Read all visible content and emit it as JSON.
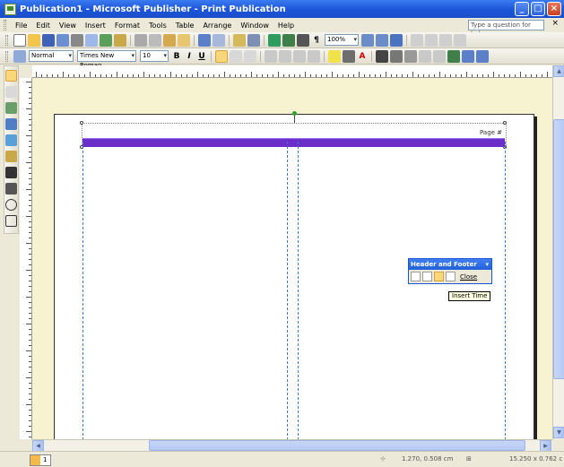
{
  "title_bar": {
    "title": "Publication1 - Microsoft Publisher - Print Publication"
  },
  "window_buttons": {
    "minimize": "_",
    "maximize": "□",
    "close": "×"
  },
  "menu": {
    "items": [
      "File",
      "Edit",
      "View",
      "Insert",
      "Format",
      "Tools",
      "Table",
      "Arrange",
      "Window",
      "Help"
    ],
    "help_placeholder": "Type a question for help",
    "close_glyph": "×"
  },
  "standard_toolbar": {
    "zoom": "100%"
  },
  "formatting_toolbar": {
    "style": "Normal",
    "font": "Times New Roman",
    "size": "10",
    "bold": "B",
    "italic": "I",
    "underline": "U",
    "text_direction": "A"
  },
  "document": {
    "header_text": "Page #"
  },
  "header_footer_toolbar": {
    "title": "Header and Footer",
    "close_label": "Close",
    "tooltip": "Insert Time"
  },
  "status_bar": {
    "page_number": "1",
    "position": "1.270, 0.508 cm",
    "size": "15.250 x 0.762 c"
  }
}
